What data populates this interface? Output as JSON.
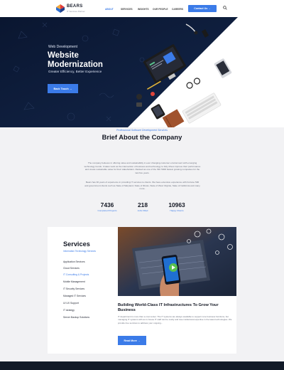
{
  "header": {
    "logo_text": "BEARS",
    "logo_tagline": "IT Services Partner",
    "nav": [
      "ABOUT",
      "SERVICES",
      "INSIGHTS",
      "OUR PEOPLE",
      "CAREERS"
    ],
    "contact_label": "Contact Us  →"
  },
  "hero": {
    "kicker": "Web Development",
    "title": "Website Modernization",
    "subtitle": "Greater Efficiency, Better Experience",
    "button_label": "Back Touch  →"
  },
  "brief": {
    "kicker": "Professional Software Development Services",
    "title": "Brief About the Company",
    "paragraph1": "The company believes in offering value and sustainability in ever changing customer environment with emerging technology trends. It takes work as the intersection of business and technology to fully drives improve their performance and create sustainable value for their stakeholders. Ranked as one of the INC 5000 fastest growing companies for the last five years.",
    "paragraph2": "Bears has 30 years of experience in providing IT services to clients. We have extensive experience with Fortune 500 and government clients such as State of Maryland, State of Illinois, State of West Virginia, State of California and many more.",
    "stats": [
      {
        "value": "7436",
        "label": "Completed Projects"
      },
      {
        "value": "218",
        "label": "Jobs Filled"
      },
      {
        "value": "10963",
        "label": "Happy Clients"
      }
    ]
  },
  "services": {
    "title": "Services",
    "subtitle": "Information Technology Services",
    "items": [
      "Application Services",
      "Cloud Services",
      "IT Consulting & Projects",
      "Mobile Management",
      "IT Security Services",
      "Managed IT Services",
      "UI UX Support",
      "IT strategy",
      "Server Backup Solutions"
    ],
    "active_index": 2,
    "heading": "Building World-Class IT Infrastructures To Grow Your Business",
    "paragraph": "IT department is more than a cost center. The IT systems are always available to support core business functions, but managing IT systems with an in-house IT staff can be costly and lose institutional expertise in the latest technologies. We provide true services to address your ongoing...",
    "button_label": "Read More  →"
  },
  "colors": {
    "accent": "#3b7be8",
    "hero_dark": "#0d1b33",
    "heading": "#141824"
  }
}
